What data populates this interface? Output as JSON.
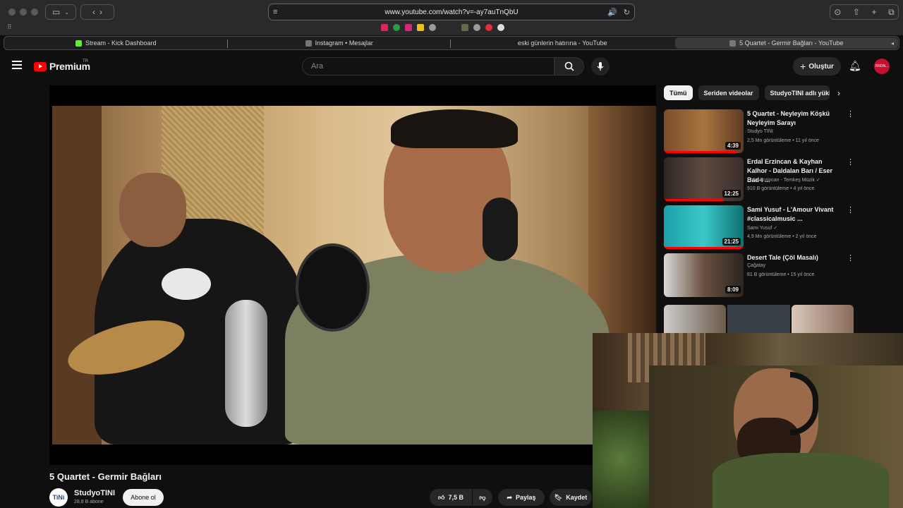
{
  "browser": {
    "url": "www.youtube.com/watch?v=-ay7auTnQbU",
    "tabs": [
      {
        "label": "Stream - Kick Dashboard",
        "active": false
      },
      {
        "label": "Instagram • Mesajlar",
        "active": false
      },
      {
        "label": "eski günlerin hatırına - YouTube",
        "active": false
      },
      {
        "label": "5 Quartet - Germir Bağları - YouTube",
        "active": true
      }
    ]
  },
  "header": {
    "logo_text": "Premium",
    "logo_superscript": "TR",
    "search_placeholder": "Ara",
    "create_label": "Oluştur",
    "avatar_text": "RRDN..."
  },
  "video": {
    "title": "5 Quartet - Germir Bağları",
    "channel_name": "StudyoTINI",
    "channel_avatar_text": "TiNi",
    "subscribers": "28,8 B abone",
    "subscribe_label": "Abone ol",
    "likes": "7,5 B",
    "share_label": "Paylaş",
    "save_label": "Kaydet"
  },
  "sidebar": {
    "chips": [
      "Tümü",
      "Seriden videolar",
      "StudyoTINI adlı yükleyici"
    ],
    "recommendations": [
      {
        "title": "5 Quartet - Neyleyim Köşkü Neyleyim Sarayı",
        "channel": "Studyo TINI",
        "meta": "2,5 Mn görüntüleme • 11 yıl önce",
        "duration": "4:39",
        "progress": 0.9
      },
      {
        "title": "Erdal Erzincan & Kayhan Kalhor - Daldalan Barı / Eser Bad-ı ...",
        "channel": "Erdal Erzincan - Temkeş Müzik",
        "meta": "910 B görüntüleme • 4 yıl önce",
        "duration": "12:25",
        "progress": 0.75
      },
      {
        "title": "Sami Yusuf - L'Amour Vivant #classicalmusic ...",
        "channel": "Sami Yusuf",
        "meta": "4,9 Mn görüntüleme • 2 yıl önce",
        "duration": "21:25",
        "progress": 1.0
      },
      {
        "title": "Desert Tale (Çöl Masalı)",
        "channel": "Çağatay",
        "meta": "81 B görüntüleme • 15 yıl önce",
        "duration": "8:09",
        "progress": 0
      }
    ]
  },
  "colors": {
    "background": "#0f0f0f",
    "accent": "#ff0000",
    "chip_active": "#f1f1f1"
  }
}
